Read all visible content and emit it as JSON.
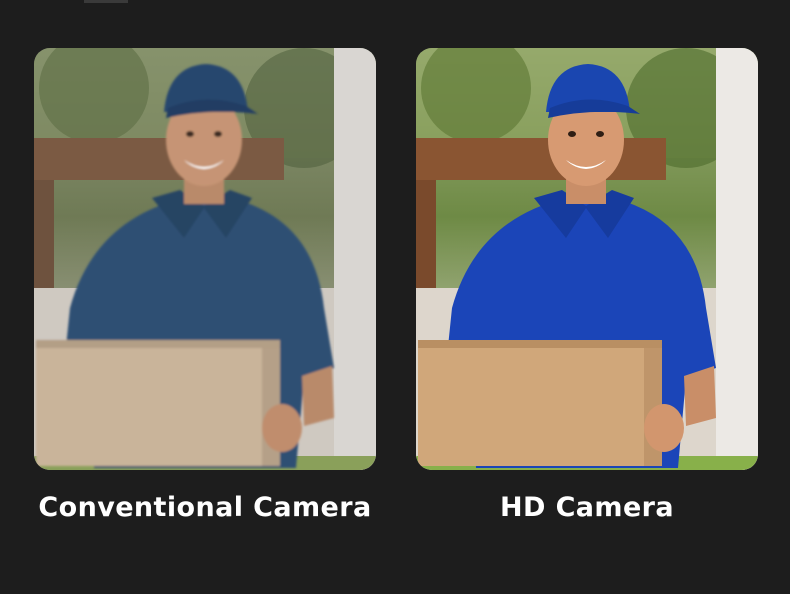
{
  "comparison": {
    "left": {
      "caption": "Conventional Camera",
      "icon": "delivery-man-photo-low-quality",
      "shirt_color": "#2f4f73",
      "cap_color": "#27466e",
      "box_color": "#c9b49a"
    },
    "right": {
      "caption": "HD Camera",
      "icon": "delivery-man-photo-high-quality",
      "shirt_color": "#1b45b8",
      "cap_color": "#1a46b0",
      "box_color": "#d0a77a"
    }
  }
}
